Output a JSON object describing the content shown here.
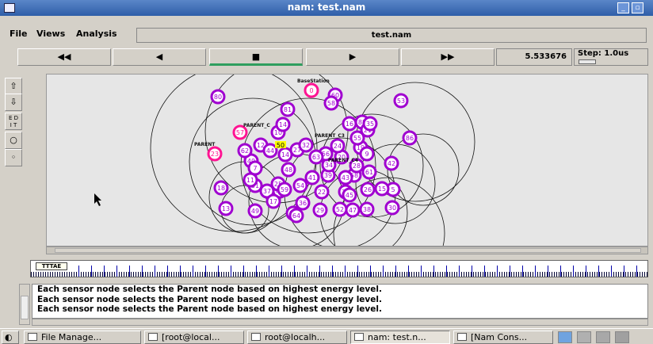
{
  "window": {
    "title": "nam: test.nam"
  },
  "menu": [
    {
      "label": "File"
    },
    {
      "label": "Views"
    },
    {
      "label": "Analysis"
    }
  ],
  "file_name": "test.nam",
  "playback": {
    "rewind": "◀◀",
    "back": "◀",
    "stop": "■",
    "play": "▶",
    "fastforward": "▶▶",
    "time": "5.533676",
    "step": "Step: 1.0us"
  },
  "tools": {
    "edit": "E D\nI T"
  },
  "canvas": {
    "labels": {
      "base_station": "BaseStation",
      "parent_c1": "PARENT_C",
      "parent_c2": "PARENT",
      "parent_c3": "PARENT_C3",
      "parent_c4": "PARENT_C4"
    },
    "highlight_label": "50",
    "nodes": [
      {
        "id": "0",
        "c": "#ff1493"
      },
      {
        "id": "60",
        "c": "#a000d0"
      },
      {
        "id": "58",
        "c": "#a000d0"
      },
      {
        "id": "80",
        "c": "#a000d0"
      },
      {
        "id": "81",
        "c": "#a000d0"
      },
      {
        "id": "53",
        "c": "#a000d0"
      },
      {
        "id": "88",
        "c": "#a000d0"
      },
      {
        "id": "57",
        "c": "#ff1493"
      },
      {
        "id": "10",
        "c": "#a000d0"
      },
      {
        "id": "14",
        "c": "#a000d0"
      },
      {
        "id": "16",
        "c": "#a000d0"
      },
      {
        "id": "21",
        "c": "#a000d0"
      },
      {
        "id": "23",
        "c": "#ff1493"
      },
      {
        "id": "35",
        "c": "#a000d0"
      },
      {
        "id": "12",
        "c": "#a000d0"
      },
      {
        "id": "86",
        "c": "#a000d0"
      },
      {
        "id": "42",
        "c": "#a000d0"
      },
      {
        "id": "40",
        "c": "#a000d0"
      },
      {
        "id": "14",
        "c": "#a000d0"
      },
      {
        "id": "5",
        "c": "#a000d0"
      },
      {
        "id": "33",
        "c": "#a000d0"
      },
      {
        "id": "39",
        "c": "#a000d0"
      },
      {
        "id": "58",
        "c": "#a000d0"
      },
      {
        "id": "26",
        "c": "#a000d0"
      },
      {
        "id": "18",
        "c": "#a000d0"
      },
      {
        "id": "45",
        "c": "#a000d0"
      },
      {
        "id": "14",
        "c": "#a000d0"
      },
      {
        "id": "37",
        "c": "#a000d0"
      },
      {
        "id": "13",
        "c": "#a000d0"
      },
      {
        "id": "49",
        "c": "#a000d0"
      },
      {
        "id": "36",
        "c": "#a000d0"
      },
      {
        "id": "22",
        "c": "#a000d0"
      },
      {
        "id": "20",
        "c": "#a000d0"
      },
      {
        "id": "34",
        "c": "#a000d0"
      },
      {
        "id": "28",
        "c": "#a000d0"
      },
      {
        "id": "41",
        "c": "#a000d0"
      },
      {
        "id": "7",
        "c": "#a000d0"
      },
      {
        "id": "44",
        "c": "#a000d0"
      },
      {
        "id": "31",
        "c": "#a000d0"
      },
      {
        "id": "43",
        "c": "#a000d0"
      },
      {
        "id": "47",
        "c": "#a000d0"
      },
      {
        "id": "15",
        "c": "#a000d0"
      },
      {
        "id": "19",
        "c": "#a000d0"
      },
      {
        "id": "24",
        "c": "#a000d0"
      },
      {
        "id": "46",
        "c": "#a000d0"
      },
      {
        "id": "27",
        "c": "#a000d0"
      },
      {
        "id": "32",
        "c": "#a000d0"
      },
      {
        "id": "38",
        "c": "#a000d0"
      },
      {
        "id": "29",
        "c": "#a000d0"
      },
      {
        "id": "30",
        "c": "#a000d0"
      },
      {
        "id": "11",
        "c": "#a000d0"
      },
      {
        "id": "25",
        "c": "#a000d0"
      },
      {
        "id": "9",
        "c": "#a000d0"
      },
      {
        "id": "17",
        "c": "#a000d0"
      },
      {
        "id": "48",
        "c": "#a000d0"
      },
      {
        "id": "52",
        "c": "#a000d0"
      },
      {
        "id": "54",
        "c": "#a000d0"
      },
      {
        "id": "55",
        "c": "#a000d0"
      },
      {
        "id": "56",
        "c": "#a000d0"
      },
      {
        "id": "59",
        "c": "#a000d0"
      },
      {
        "id": "61",
        "c": "#a000d0"
      },
      {
        "id": "62",
        "c": "#a000d0"
      },
      {
        "id": "63",
        "c": "#a000d0"
      },
      {
        "id": "64",
        "c": "#a000d0"
      }
    ]
  },
  "timeline": {
    "marker": "TTTAE"
  },
  "console": {
    "lines": [
      "Each sensor node selects the Parent node based on highest energy level.",
      "Each sensor node selects the Parent node based on highest energy level.",
      "Each sensor node selects the Parent node based on highest energy level."
    ]
  },
  "taskbar": {
    "items": [
      {
        "label": "File Manage..."
      },
      {
        "label": "[root@local..."
      },
      {
        "label": "root@localh..."
      },
      {
        "label": "nam: test.n..."
      },
      {
        "label": "[Nam Cons..."
      }
    ],
    "swatch_colors": [
      "#6fa3e0",
      "#b0b0b0",
      "#a8a8a8",
      "#a0a0a0"
    ]
  },
  "colors": {
    "node_purple": "#a000d0",
    "node_pink": "#ff1493",
    "highlight": "#ffff00",
    "titlebar": "#2f5ea8"
  }
}
